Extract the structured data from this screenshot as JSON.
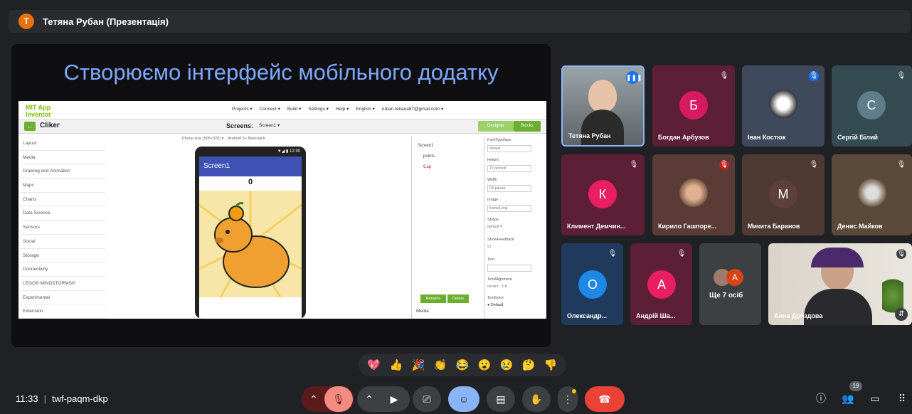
{
  "presenter_bar": {
    "avatar_letter": "T",
    "title": "Тетяна Рубан (Презентація)"
  },
  "slide": {
    "title": "Створюємо інтерфейс мобільного додатку",
    "appinventor": {
      "logo": "MIT App Inventor",
      "menus": [
        "Projects ▾",
        "Connect ▾",
        "Build ▾",
        "Settings ▾",
        "Help ▾",
        "English ▾",
        "ruban.tetiana87@gmail.com ▾"
      ],
      "project": "Cliker",
      "screens_label": "Screens:",
      "screen_select": "Screen1 ▾",
      "designer_btn": "Designer",
      "blocks_btn": "Blocks",
      "palette": [
        "Layout",
        "Media",
        "Drawing and Animation",
        "Maps",
        "Charts",
        "Data Science",
        "Sensors",
        "Social",
        "Storage",
        "Connectivity",
        "LEGO® MINDSTORMS®",
        "Experimental",
        "Extension"
      ],
      "viewer_opts": [
        "Phone size (505×320) ▾",
        "Android 5+ Material ▾"
      ],
      "phone_status": "▼◢ ▮ 12:30",
      "phone_title": "Screen1",
      "phone_counter": "0",
      "components": [
        "Screen1",
        "points",
        "Cap"
      ],
      "rename_btn": "Rename",
      "delete_btn": "Delete",
      "media_label": "Media",
      "props": [
        {
          "label": "FontTypeface",
          "value": "default"
        },
        {
          "label": "Height",
          "value": "70 percent"
        },
        {
          "label": "Width",
          "value": "Fill parent"
        },
        {
          "label": "Image",
          "value": "frame4.png"
        },
        {
          "label": "Shape",
          "value": "default ▾"
        },
        {
          "label": "ShowFeedback",
          "value": "☑"
        },
        {
          "label": "Text",
          "value": ""
        },
        {
          "label": "TextAlignment",
          "value": "center : 1 ▾"
        },
        {
          "label": "TextColor",
          "value": "● Default"
        }
      ]
    }
  },
  "participants": [
    {
      "name": "Тетяна Рубан",
      "letter": "",
      "color": "#5f6368",
      "speaking": true
    },
    {
      "name": "Богдан Арбузов",
      "letter": "Б",
      "color": "#d81b60"
    },
    {
      "name": "Іван Костюк",
      "letter": "",
      "color": "#4e6a8e"
    },
    {
      "name": "Сергій Білий",
      "letter": "С",
      "color": "#607d8b"
    },
    {
      "name": "Климент Демчин...",
      "letter": "К",
      "color": "#e91e63"
    },
    {
      "name": "Кирило Гашпоре...",
      "letter": "",
      "color": "#6d4c41"
    },
    {
      "name": "Микита Баранов",
      "letter": "М",
      "color": "#5d4037"
    },
    {
      "name": "Денис Майков",
      "letter": "",
      "color": "#795548"
    },
    {
      "name": "Олександр...",
      "letter": "О",
      "color": "#1e88e5"
    },
    {
      "name": "Андрій Ша...",
      "letter": "А",
      "color": "#e91e63"
    },
    {
      "name": "Ще 7 осіб",
      "letter": "А",
      "color": "#d84315"
    },
    {
      "name": "Анна Дроздова",
      "letter": "",
      "color": "#9e9e9e"
    }
  ],
  "reactions": [
    "💖",
    "👍",
    "🎉",
    "👏",
    "😂",
    "😮",
    "😢",
    "🤔",
    "👎"
  ],
  "bottom": {
    "time": "11:33",
    "meeting_code": "twf-paqm-dkp",
    "people_count": "19"
  },
  "colors": {
    "end_call": "#ea4335",
    "mic_off": "#f28b82",
    "active_btn": "#8ab4f8"
  }
}
